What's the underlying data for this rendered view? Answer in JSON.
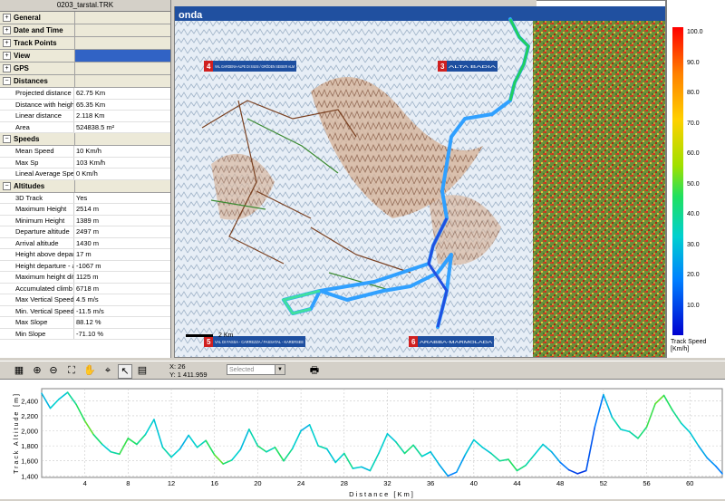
{
  "file_title": "0203_tarstal.TRK",
  "panel": {
    "sections": [
      {
        "label": "General",
        "open": false,
        "rows": []
      },
      {
        "label": "Date and Time",
        "open": false,
        "rows": []
      },
      {
        "label": "Track Points",
        "open": false,
        "rows": []
      },
      {
        "label": "View",
        "open": false,
        "selected": true,
        "rows": []
      },
      {
        "label": "GPS",
        "open": false,
        "rows": []
      },
      {
        "label": "Distances",
        "open": true,
        "rows": [
          {
            "label": "Projected distance",
            "value": "62.75 Km"
          },
          {
            "label": "Distance with height",
            "value": "65.35 Km"
          },
          {
            "label": "Linear distance",
            "value": "2.118 Km"
          },
          {
            "label": "Area",
            "value": "524838.5 m²"
          }
        ]
      },
      {
        "label": "Speeds",
        "open": true,
        "rows": [
          {
            "label": "Mean Speed",
            "value": "10 Km/h"
          },
          {
            "label": "Max Sp",
            "value": "103 Km/h"
          },
          {
            "label": "Lineal Average Spee",
            "value": "0 Km/h"
          }
        ]
      },
      {
        "label": "Altitudes",
        "open": true,
        "rows": [
          {
            "label": "3D Track",
            "value": "Yes"
          },
          {
            "label": "Maximum Height",
            "value": "2514 m"
          },
          {
            "label": "Minimum Height",
            "value": "1389 m"
          },
          {
            "label": "Departure altitude",
            "value": "2497 m"
          },
          {
            "label": "Arrival altitude",
            "value": "1430 m"
          },
          {
            "label": "Height above depart",
            "value": "17 m"
          },
          {
            "label": "Height departure - arr",
            "value": "-1067 m"
          },
          {
            "label": "Maximum height diffe",
            "value": "1125 m"
          },
          {
            "label": "Accumulated climb",
            "value": "6718 m"
          },
          {
            "label": "Max Vertical Speed",
            "value": "4.5 m/s"
          },
          {
            "label": "Min. Vertical Speed",
            "value": "-11.5 m/s"
          },
          {
            "label": "Max Slope",
            "value": "88.12 %"
          },
          {
            "label": "Min Slope",
            "value": "-71.10 %"
          }
        ]
      }
    ]
  },
  "map": {
    "brand": "onda",
    "callouts": [
      {
        "num": "4",
        "text": "VAL GARDENA-ALPE DI SIUSI / GRÖDEN SEISER ALM"
      },
      {
        "num": "3",
        "text": "ALTA BADIA"
      },
      {
        "num": "5",
        "text": "VAL DI FASSA - CARREZZA / FASSATAL - KARERSEE"
      },
      {
        "num": "6",
        "text": "ARABBA-MARMOLADA"
      }
    ],
    "scale_label": "2 Km"
  },
  "legend": {
    "ticks": [
      "100.0",
      "90.0",
      "80.0",
      "70.0",
      "60.0",
      "50.0",
      "40.0",
      "30.0",
      "20.0",
      "10.0"
    ],
    "caption": "Track Speed [Km/h]"
  },
  "graph_toolbar": {
    "x_label": "X: 26",
    "y_label": "Y: 1 411.959",
    "select_value": "Selected"
  },
  "chart_data": {
    "type": "line",
    "xlabel": "Distance [Km]",
    "ylabel": "Track Altitude [m]",
    "xlim": [
      0,
      63
    ],
    "ylim": [
      1380,
      2560
    ],
    "x_ticks": [
      4,
      8,
      12,
      16,
      20,
      24,
      28,
      32,
      36,
      40,
      44,
      48,
      52,
      56,
      60
    ],
    "y_ticks": [
      1400,
      1600,
      1800,
      2000,
      2200,
      2400
    ],
    "grid": true,
    "x": [
      0,
      0.8,
      1.6,
      2.4,
      3.2,
      4,
      4.8,
      5.6,
      6.4,
      7.2,
      8,
      8.8,
      9.6,
      10.4,
      11.2,
      12,
      12.8,
      13.6,
      14.4,
      15.2,
      16,
      16.8,
      17.6,
      18.4,
      19.2,
      20,
      20.8,
      21.6,
      22.4,
      23.2,
      24,
      24.8,
      25.6,
      26.4,
      27.2,
      28,
      28.8,
      29.6,
      30.4,
      31.2,
      32,
      32.8,
      33.6,
      34.4,
      35.2,
      36,
      36.8,
      37.6,
      38.4,
      39.2,
      40,
      40.8,
      41.6,
      42.4,
      43.2,
      44,
      44.8,
      45.6,
      46.4,
      47.2,
      48,
      48.8,
      49.6,
      50.4,
      51.2,
      52,
      52.8,
      53.6,
      54.4,
      55.2,
      56,
      56.8,
      57.6,
      58.4,
      59.2,
      60,
      60.8,
      61.6,
      62.4,
      63
    ],
    "y": [
      2497,
      2300,
      2420,
      2510,
      2350,
      2130,
      1950,
      1820,
      1720,
      1690,
      1900,
      1820,
      1950,
      2150,
      1780,
      1650,
      1760,
      1940,
      1780,
      1870,
      1680,
      1560,
      1610,
      1750,
      2020,
      1800,
      1720,
      1780,
      1600,
      1760,
      2000,
      2080,
      1800,
      1760,
      1580,
      1700,
      1500,
      1520,
      1470,
      1700,
      1960,
      1850,
      1700,
      1810,
      1660,
      1720,
      1550,
      1400,
      1450,
      1680,
      1880,
      1780,
      1700,
      1600,
      1620,
      1470,
      1540,
      1680,
      1820,
      1720,
      1580,
      1480,
      1430,
      1470,
      2050,
      2480,
      2180,
      2020,
      1990,
      1900,
      2050,
      2360,
      2470,
      2270,
      2100,
      1980,
      1800,
      1640,
      1530,
      1430
    ],
    "speed": [
      20,
      25,
      30,
      28,
      35,
      40,
      45,
      38,
      30,
      34,
      42,
      40,
      36,
      30,
      28,
      33,
      30,
      24,
      30,
      32,
      40,
      45,
      38,
      30,
      26,
      33,
      38,
      32,
      40,
      36,
      30,
      24,
      30,
      33,
      28,
      30,
      36,
      30,
      26,
      32,
      30,
      28,
      34,
      38,
      35,
      30,
      26,
      22,
      15,
      20,
      27,
      30,
      28,
      34,
      36,
      40,
      37,
      33,
      30,
      28,
      22,
      14,
      8,
      6,
      10,
      14,
      25,
      33,
      30,
      34,
      38,
      42,
      45,
      40,
      36,
      30,
      28,
      22,
      18,
      15
    ]
  }
}
